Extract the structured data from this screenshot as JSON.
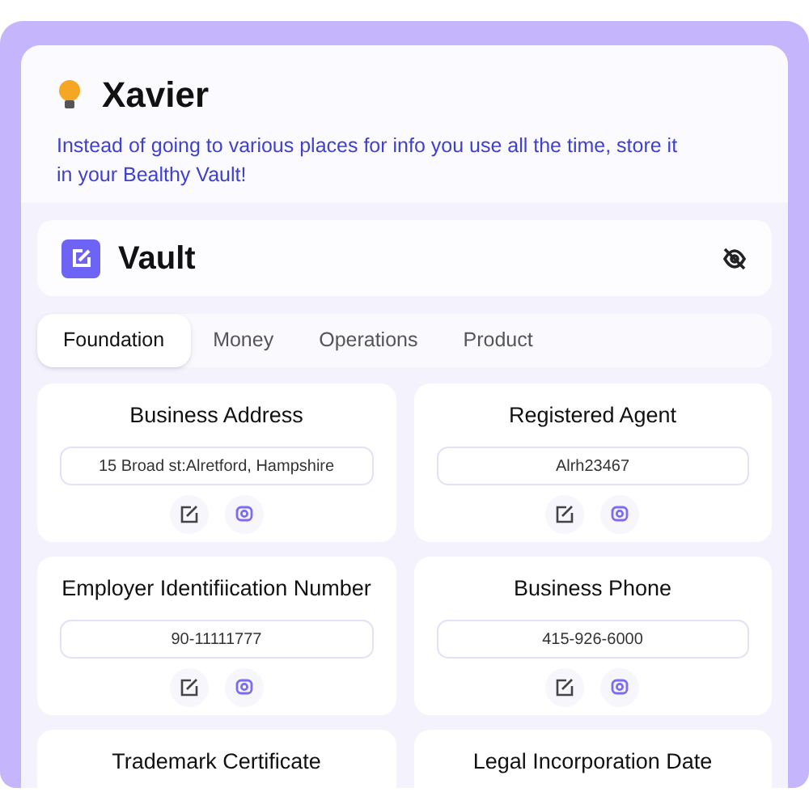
{
  "header": {
    "title": "Xavier",
    "description": "Instead of going to various places for info you use all the time, store it in your Bealthy Vault!"
  },
  "vault": {
    "title": "Vault"
  },
  "tabs": [
    {
      "label": "Foundation",
      "selected": true
    },
    {
      "label": "Money",
      "selected": false
    },
    {
      "label": "Operations",
      "selected": false
    },
    {
      "label": "Product",
      "selected": false
    }
  ],
  "cards": [
    {
      "title": "Business Address",
      "value": "15 Broad st:Alretford, Hampshire"
    },
    {
      "title": "Registered Agent",
      "value": "Alrh23467"
    },
    {
      "title": "Employer Identifiication Number",
      "value": "90-11111777"
    },
    {
      "title": "Business Phone",
      "value": "415-926-6000"
    },
    {
      "title": "Trademark Certificate"
    },
    {
      "title": "Legal Incorporation Date"
    }
  ]
}
